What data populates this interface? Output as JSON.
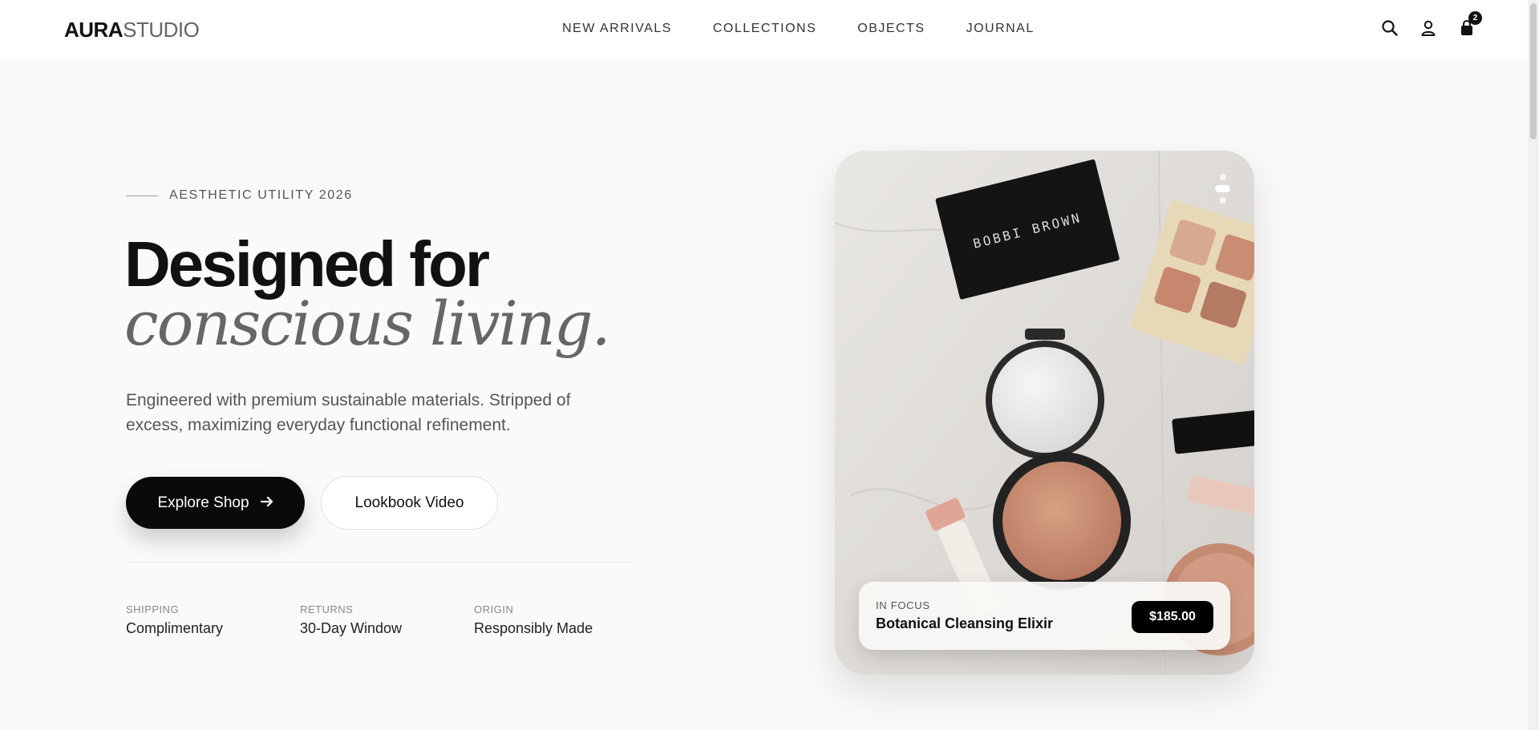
{
  "nav": {
    "logo_bold": "AURA",
    "logo_light": "STUDIO",
    "items": [
      "NEW ARRIVALS",
      "COLLECTIONS",
      "OBJECTS",
      "JOURNAL"
    ],
    "cart_count": "2"
  },
  "hero": {
    "eyebrow": "AESTHETIC UTILITY 2026",
    "headline": "Designed for",
    "headline_italic": "conscious living.",
    "description": "Engineered with premium sustainable materials. Stripped of excess, maximizing everyday functional refinement.",
    "primary_cta": "Explore Shop",
    "secondary_cta": "Lookbook Video"
  },
  "stats": [
    {
      "label": "SHIPPING",
      "value": "Complimentary"
    },
    {
      "label": "RETURNS",
      "value": "30-Day Window"
    },
    {
      "label": "ORIGIN",
      "value": "Responsibly Made"
    }
  ],
  "product": {
    "eyebrow": "IN FOCUS",
    "name": "Botanical Cleansing Elixir",
    "price": "$185.00",
    "brand_on_image": "BOBBI BROWN"
  },
  "icons": [
    "search-icon",
    "user-icon",
    "bag-icon",
    "arrow-right-icon"
  ]
}
